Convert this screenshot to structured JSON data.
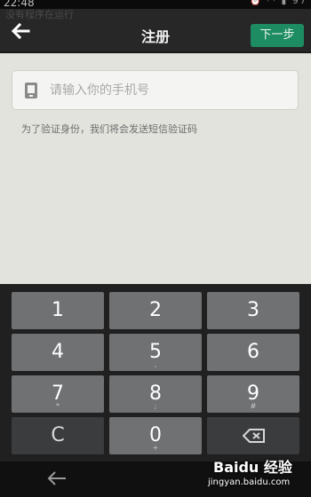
{
  "status_bar": {
    "time": "22:48",
    "battery": "97"
  },
  "notification_text": "没有程序在运行",
  "header": {
    "title": "注册",
    "next_label": "下一步"
  },
  "phone_field": {
    "placeholder": "请输入你的手机号",
    "value": ""
  },
  "hint": "为了验证身份，我们将会发送短信验证码",
  "keypad": {
    "keys": [
      {
        "digit": "1",
        "sub": ""
      },
      {
        "digit": "2",
        "sub": ""
      },
      {
        "digit": "3",
        "sub": ""
      },
      {
        "digit": "4",
        "sub": ""
      },
      {
        "digit": "5",
        "sub": ","
      },
      {
        "digit": "6",
        "sub": ""
      },
      {
        "digit": "7",
        "sub": "*"
      },
      {
        "digit": "8",
        "sub": ";"
      },
      {
        "digit": "9",
        "sub": "#"
      },
      {
        "digit": "C",
        "sub": ""
      },
      {
        "digit": "0",
        "sub": "+"
      }
    ]
  },
  "watermark": {
    "brand": "Baidu 经验",
    "url": "jingyan.baidu.com"
  }
}
